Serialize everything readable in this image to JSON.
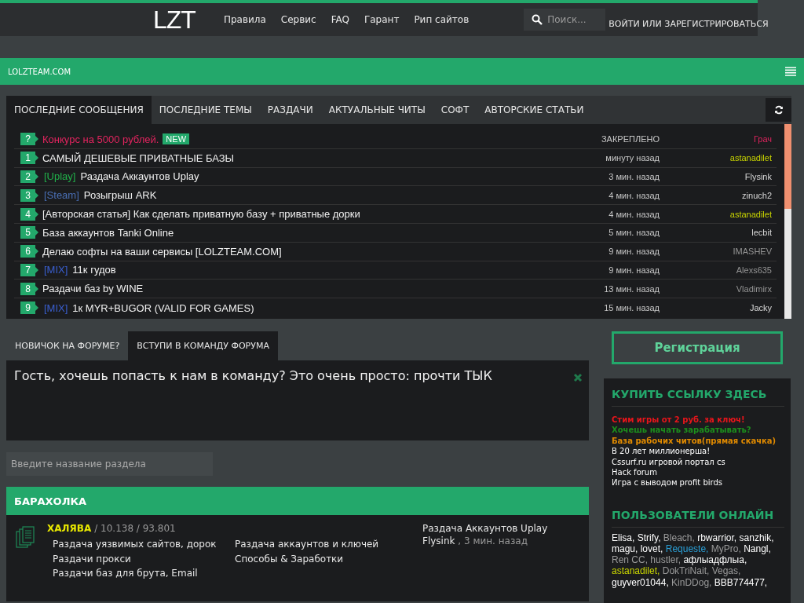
{
  "header": {
    "logo": "LZT",
    "nav": [
      "Правила",
      "Сервис",
      "FAQ",
      "Гарант",
      "Рип сайтов"
    ],
    "search": {
      "placeholder": "Поиск..."
    },
    "login": "ВОЙТИ ИЛИ ЗАРЕГИСТРИРОВАТЬСЯ"
  },
  "breadcrumb": "LOLZTEAM.COM",
  "thread_tabs": [
    {
      "label": "ПОСЛЕДНИЕ СООБЩЕНИЯ",
      "selected": true
    },
    {
      "label": "ПОСЛЕДНИЕ ТЕМЫ",
      "selected": false
    },
    {
      "label": "РАЗДАЧИ",
      "selected": false
    },
    {
      "label": "АКТУАЛЬНЫЕ ЧИТЫ",
      "selected": false
    },
    {
      "label": "СОФТ",
      "selected": false
    },
    {
      "label": "АВТОРСКИЕ СТАТЬИ",
      "selected": false
    }
  ],
  "threads": [
    {
      "kind": "sticky",
      "number": "?",
      "title": "Конкурс на 5000 рублей.",
      "badge": "NEW",
      "time": "ЗАКРЕПЛЕНО",
      "author": {
        "name": "Грач",
        "color": "#e0245e"
      }
    },
    {
      "kind": "normal",
      "number": "1",
      "title": "САМЫЙ ДЕШЕВЫЕ ПРИВАТНЫЕ БАЗЫ",
      "time": "минуту назад",
      "author": {
        "name": "astanadilet",
        "color": "#c8d400"
      }
    },
    {
      "kind": "normal",
      "number": "2",
      "prefix": {
        "text": "[Uplay]",
        "color": "#21b04a"
      },
      "title": "Раздача Аккаунтов Uplay",
      "time": "3 мин. назад",
      "author": {
        "name": "Flysink",
        "color": "#d6d6d6"
      }
    },
    {
      "kind": "normal",
      "number": "3",
      "prefix": {
        "text": "[Steam]",
        "color": "#4a6fb5"
      },
      "title": "Розыгрыш ARK",
      "time": "4 мин. назад",
      "author": {
        "name": "zinuch2",
        "color": "#d6d6d6"
      }
    },
    {
      "kind": "normal",
      "number": "4",
      "title": "[Авторская статья] Как сделать приватную базу + приватные дорки",
      "time": "4 мин. назад",
      "author": {
        "name": "astanadilet",
        "color": "#c8d400"
      }
    },
    {
      "kind": "normal",
      "number": "5",
      "title": "База аккаунтов Tanki Online",
      "time": "5 мин. назад",
      "author": {
        "name": "lecbit",
        "color": "#d6d6d6"
      }
    },
    {
      "kind": "normal",
      "number": "6",
      "title": "Делаю софты на ваши сервисы [LOLZTEAM.COM]",
      "time": "9 мин. назад",
      "author": {
        "name": "IMASHEV",
        "color": "#949494"
      }
    },
    {
      "kind": "normal",
      "number": "7",
      "prefix": {
        "text": "[MIX]",
        "color": "#3a5fd0"
      },
      "title": "11к гудов",
      "time": "9 мин. назад",
      "author": {
        "name": "Alexs635",
        "color": "#949494"
      }
    },
    {
      "kind": "normal",
      "number": "8",
      "title": "Раздачи баз by WINE",
      "time": "13 мин. назад",
      "author": {
        "name": "Vladimirx",
        "color": "#949494"
      }
    },
    {
      "kind": "normal",
      "number": "9",
      "prefix": {
        "text": "[MIX]",
        "color": "#3a5fd0"
      },
      "title": "1к MYR+BUGOR (VALID FOR GAMES)",
      "time": "15 мин. назад",
      "author": {
        "name": "Jacky",
        "color": "#d6d6d6"
      }
    }
  ],
  "info_tabs": [
    {
      "label": "НОВИЧОК НА ФОРУМЕ?",
      "selected": false
    },
    {
      "label": "ВСТУПИ В КОМАНДУ ФОРУМА",
      "selected": true
    }
  ],
  "info_text": "Гость, хочешь попасть к нам в команду? Это очень просто: прочти ТЫК",
  "section_filter": {
    "placeholder": "Введите название раздела"
  },
  "category": {
    "title": "БАРАХОЛКА",
    "forum": {
      "name": "ХАЛЯВА",
      "stats": "/ 10.138 / 93.801",
      "subforums": [
        "Раздача уязвимых сайтов, дорок",
        "Раздачи прокси",
        "Раздачи баз для брута, Email",
        "Раздача аккаунтов и ключей",
        "Способы & Заработки"
      ],
      "last_post": {
        "title": "Раздача Аккаунтов Uplay",
        "author": "Flysink",
        "time": ", 3 мин. назад"
      }
    }
  },
  "sidebar": {
    "register": "Регистрация",
    "ads": {
      "title": "КУПИТЬ ССЫЛКУ ЗДЕСЬ",
      "links": [
        {
          "text": "Стим игры от 2 руб. за ключ!",
          "color": "#e8151b"
        },
        {
          "text": "Хочешь начать зарабатывать?",
          "color": "#1c8f1c"
        },
        {
          "text": "База рабочих читов(прямая скачка)",
          "color": "#e08a00"
        },
        {
          "text": "В 20 лет миллионерша!",
          "color": "#ffffff"
        },
        {
          "text": "Cssurf.ru игровой портал cs",
          "color": "#ffffff"
        },
        {
          "text": "Hack forum",
          "color": "#ffffff"
        },
        {
          "text": "Игра с выводом profit birds",
          "color": "#ffffff"
        }
      ]
    },
    "online": {
      "title": "ПОЛЬЗОВАТЕЛИ ОНЛАЙН",
      "users": [
        {
          "name": "Elisa,",
          "color": "#ffffff"
        },
        {
          "name": "Strify,",
          "color": "#ffffff"
        },
        {
          "name": "Bleach,",
          "color": "#9a9a9a"
        },
        {
          "name": "rbwarrior,",
          "color": "#ffffff"
        },
        {
          "name": "sanzhik,",
          "color": "#ffffff"
        },
        {
          "name": "magu,",
          "color": "#ffffff"
        },
        {
          "name": "lovet,",
          "color": "#ffffff"
        },
        {
          "name": "Requeste,",
          "color": "#2a9fd6"
        },
        {
          "name": "MyPro,",
          "color": "#9a9a9a"
        },
        {
          "name": "Nangl,",
          "color": "#ffffff"
        },
        {
          "name": "Ren CC,",
          "color": "#9a9a9a"
        },
        {
          "name": "hustler,",
          "color": "#9a9a9a"
        },
        {
          "name": "афлыадфлыа,",
          "color": "#ffffff"
        },
        {
          "name": "astanadilet,",
          "color": "#c8d400"
        },
        {
          "name": "DokTriNait,",
          "color": "#9a9a9a"
        },
        {
          "name": "Vegas,",
          "color": "#9a9a9a"
        },
        {
          "name": "guyver01044,",
          "color": "#ffffff"
        },
        {
          "name": "KinDDog,",
          "color": "#9a9a9a"
        },
        {
          "name": "BBB774477,",
          "color": "#ffffff"
        }
      ]
    }
  }
}
